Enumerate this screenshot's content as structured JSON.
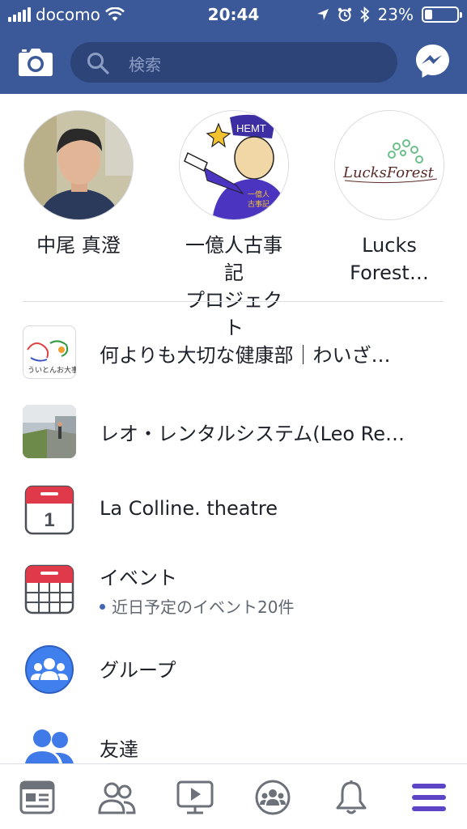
{
  "status_bar": {
    "carrier": "docomo",
    "time": "20:44",
    "battery": "23%",
    "battery_level": 0.23
  },
  "header": {
    "search_placeholder": "検索",
    "camera_icon": "camera-icon",
    "messenger_icon": "messenger-icon",
    "brand_color": "#3b5998"
  },
  "shortcuts": [
    {
      "name": "中尾 真澄"
    },
    {
      "name_line1": "一億人古事記",
      "name_line2": "プロジェクト",
      "image_text": "HEMT"
    },
    {
      "name_line1": "Lucks",
      "name_line2": "Forest…",
      "logo_text": "LucksForest"
    }
  ],
  "menu": [
    {
      "label": "何よりも大切な健康部｜わいざ…"
    },
    {
      "label": "レオ・レンタルシステム(Leo Re…"
    },
    {
      "label": "La Colline. theatre",
      "calendar_day": "1"
    },
    {
      "label": "イベント",
      "sub": "近日予定のイベント20件"
    },
    {
      "label": "グループ"
    },
    {
      "label": "友達"
    }
  ],
  "tabs": [
    {
      "icon": "news-feed-icon"
    },
    {
      "icon": "friends-icon"
    },
    {
      "icon": "watch-icon"
    },
    {
      "icon": "groups-icon"
    },
    {
      "icon": "notifications-icon"
    },
    {
      "icon": "menu-icon",
      "active": true
    }
  ],
  "colors": {
    "accent": "#4267b2",
    "active_tab": "#5b45c6",
    "calendar_red": "#e0394a"
  }
}
